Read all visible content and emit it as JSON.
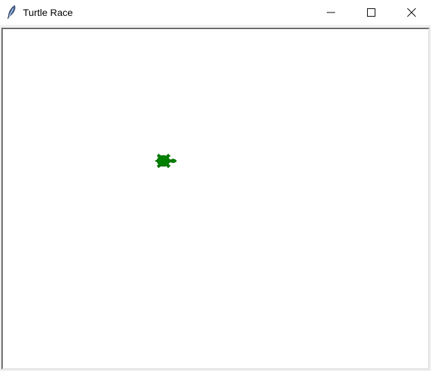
{
  "window": {
    "title": "Turtle Race",
    "app_icon": "feather-icon",
    "controls": {
      "minimize_icon": "minimize-icon",
      "maximize_icon": "maximize-icon",
      "close_icon": "close-icon"
    }
  },
  "canvas": {
    "background_color": "#ffffff",
    "turtle": {
      "shape": "turtle",
      "fill_color": "#008000",
      "heading": "east"
    }
  }
}
